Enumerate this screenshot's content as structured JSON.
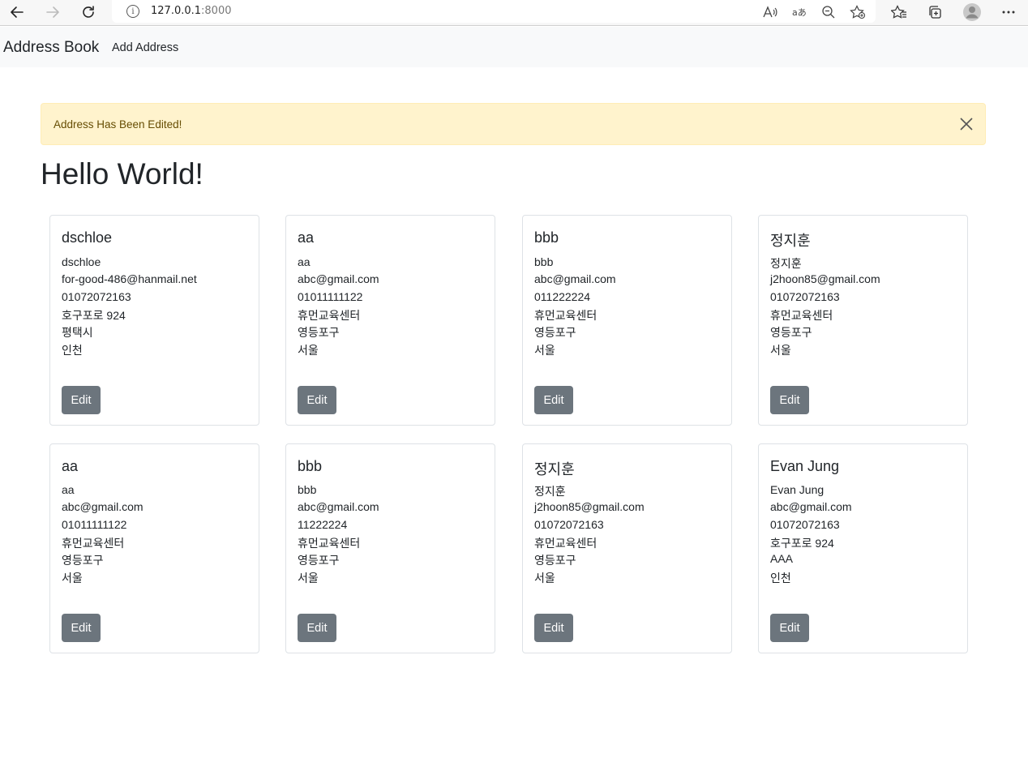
{
  "browser": {
    "url_host": "127.0.0.1",
    "url_port": ":8000"
  },
  "navbar": {
    "brand": "Address Book",
    "add_link": "Add Address"
  },
  "alert": {
    "message": "Address Has Been Edited!"
  },
  "page": {
    "heading": "Hello World!"
  },
  "cards": [
    {
      "title": "dschloe",
      "lines": [
        "dschloe",
        "for-good-486@hanmail.net",
        "01072072163",
        "호구포로 924",
        "평택시",
        "인천"
      ],
      "button": "Edit"
    },
    {
      "title": "aa",
      "lines": [
        "aa",
        "abc@gmail.com",
        "01011111122",
        "휴먼교육센터",
        "영등포구",
        "서울"
      ],
      "button": "Edit"
    },
    {
      "title": "bbb",
      "lines": [
        "bbb",
        "abc@gmail.com",
        "011222224",
        "휴먼교육센터",
        "영등포구",
        "서울"
      ],
      "button": "Edit"
    },
    {
      "title": "정지훈",
      "lines": [
        "정지훈",
        "j2hoon85@gmail.com",
        "01072072163",
        "휴먼교육센터",
        "영등포구",
        "서울"
      ],
      "button": "Edit"
    },
    {
      "title": "aa",
      "lines": [
        "aa",
        "abc@gmail.com",
        "01011111122",
        "휴먼교육센터",
        "영등포구",
        "서울"
      ],
      "button": "Edit"
    },
    {
      "title": "bbb",
      "lines": [
        "bbb",
        "abc@gmail.com",
        "11222224",
        "휴먼교육센터",
        "영등포구",
        "서울"
      ],
      "button": "Edit"
    },
    {
      "title": "정지훈",
      "lines": [
        "정지훈",
        "j2hoon85@gmail.com",
        "01072072163",
        "휴먼교육센터",
        "영등포구",
        "서울"
      ],
      "button": "Edit"
    },
    {
      "title": "Evan Jung",
      "lines": [
        "Evan Jung",
        "abc@gmail.com",
        "01072072163",
        "호구포로 924",
        "AAA",
        "인천"
      ],
      "button": "Edit"
    }
  ]
}
